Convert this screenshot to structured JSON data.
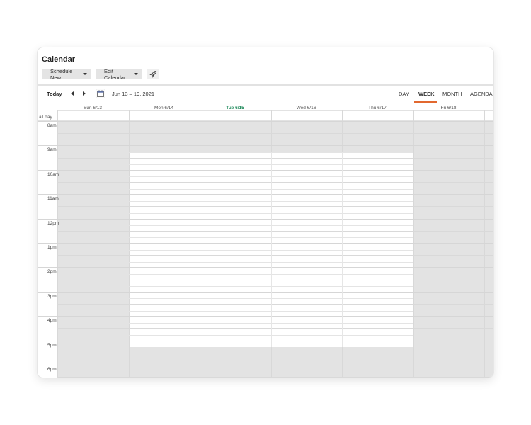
{
  "header": {
    "title": "Calendar"
  },
  "toolbar": {
    "schedule_label": "Schedule New",
    "edit_label": "Edit Calendar",
    "rocket_icon": "rocket-icon"
  },
  "nav": {
    "today_label": "Today",
    "prev_icon": "chevron-left-icon",
    "next_icon": "chevron-right-icon",
    "calendar_icon": "calendar-icon",
    "range_label": "Jun 13 – 19, 2021"
  },
  "views": {
    "day": "DAY",
    "week": "WEEK",
    "month": "MONTH",
    "agenda": "AGENDA",
    "active": "WEEK"
  },
  "colors": {
    "accent": "#e2682f",
    "today": "#1f8a5b",
    "unavailable": "#e3e3e3"
  },
  "days": [
    "Sun 6/13",
    "Mon 6/14",
    "Tue 6/15",
    "Wed 6/16",
    "Thu 6/17",
    "Fri 6/18"
  ],
  "today_index": 2,
  "allday_label": "all day",
  "hours": [
    "8am",
    "9am",
    "10am",
    "11am",
    "12pm",
    "1pm",
    "2pm",
    "3pm",
    "4pm",
    "5pm",
    "6pm"
  ]
}
